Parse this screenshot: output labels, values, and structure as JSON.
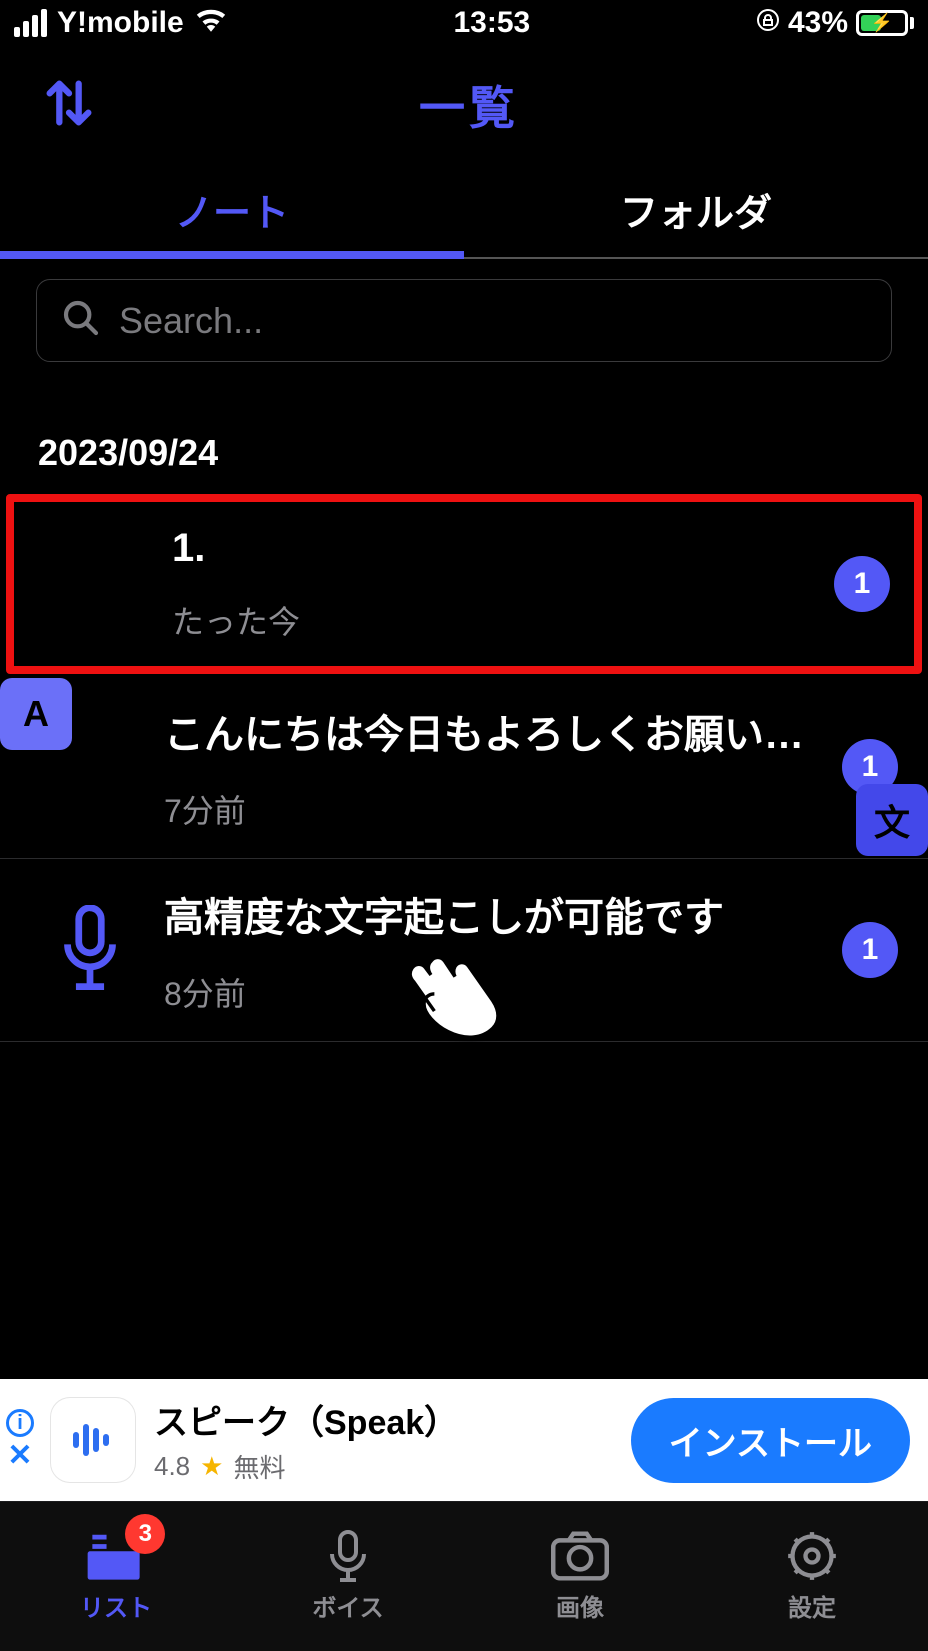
{
  "status": {
    "carrier": "Y!mobile",
    "time": "13:53",
    "battery_pct": "43%"
  },
  "header": {
    "title": "一覧"
  },
  "tabs": {
    "note": "ノート",
    "folder": "フォルダ"
  },
  "search": {
    "placeholder": "Search..."
  },
  "date_header": "2023/09/24",
  "notes": [
    {
      "title": "1.",
      "subtitle": "たった今",
      "badge": "1",
      "icon": "none"
    },
    {
      "title": "こんにちは今日もよろしくお願い…",
      "subtitle": "7分前",
      "badge": "1",
      "icon": "translate"
    },
    {
      "title": "高精度な文字起こしが可能です",
      "subtitle": "8分前",
      "badge": "1",
      "icon": "mic"
    }
  ],
  "ad": {
    "title": "スピーク（Speak）",
    "rating": "4.8",
    "price": "無料",
    "cta": "インストール"
  },
  "tabbar": {
    "list": "リスト",
    "voice": "ボイス",
    "image": "画像",
    "settings": "設定",
    "badge": "3"
  }
}
